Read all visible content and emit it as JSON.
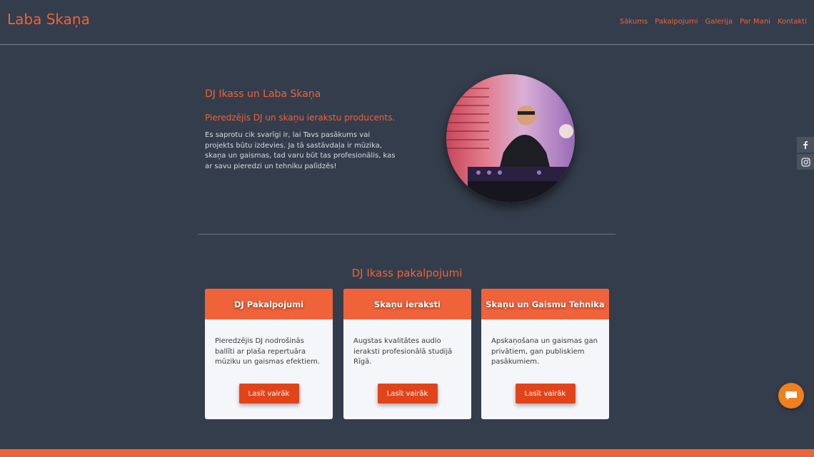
{
  "header": {
    "logo": "Laba Skaņa",
    "nav": [
      "Sākums",
      "Pakalpojumi",
      "Galerija",
      "Par Mani",
      "Kontakti"
    ]
  },
  "hero": {
    "title": "DJ Ikass un Laba Skaņa",
    "subtitle": "Pieredzējis DJ un skaņu ierakstu producents.",
    "text": "Es saprotu cik svarīgi ir, lai Tavs pasākums vai projekts būtu izdevies. Ja tā sastāvdaļa ir mūzika, skaņa un gaismas, tad varu būt tas profesionālis, kas ar savu pieredzi un tehniku palīdzēs!"
  },
  "social": [
    "facebook-icon",
    "instagram-icon"
  ],
  "services": {
    "title": "DJ Ikass pakalpojumi",
    "cards": [
      {
        "title": "DJ Pakalpojumi",
        "text": "Pieredzējis DJ nodrošinās ballīti ar plaša repertuāra mūziku un gaismas efektiem.",
        "button": "Lasīt vairāk"
      },
      {
        "title": "Skaņu ieraksti",
        "text": "Augstas kvalitātes audio ieraksti profesionālā studijā Rīgā.",
        "button": "Lasīt vairāk"
      },
      {
        "title": "Skaņu un Gaismu Tehnika",
        "text": "Apskaņošana un gaismas gan privātiem, gan publiskiem pasākumiem.",
        "button": "Lasīt vairāk"
      }
    ]
  },
  "colors": {
    "accent": "#f0623a",
    "background": "#343d4b",
    "button": "#e2441a",
    "chat": "#f07f1d"
  }
}
